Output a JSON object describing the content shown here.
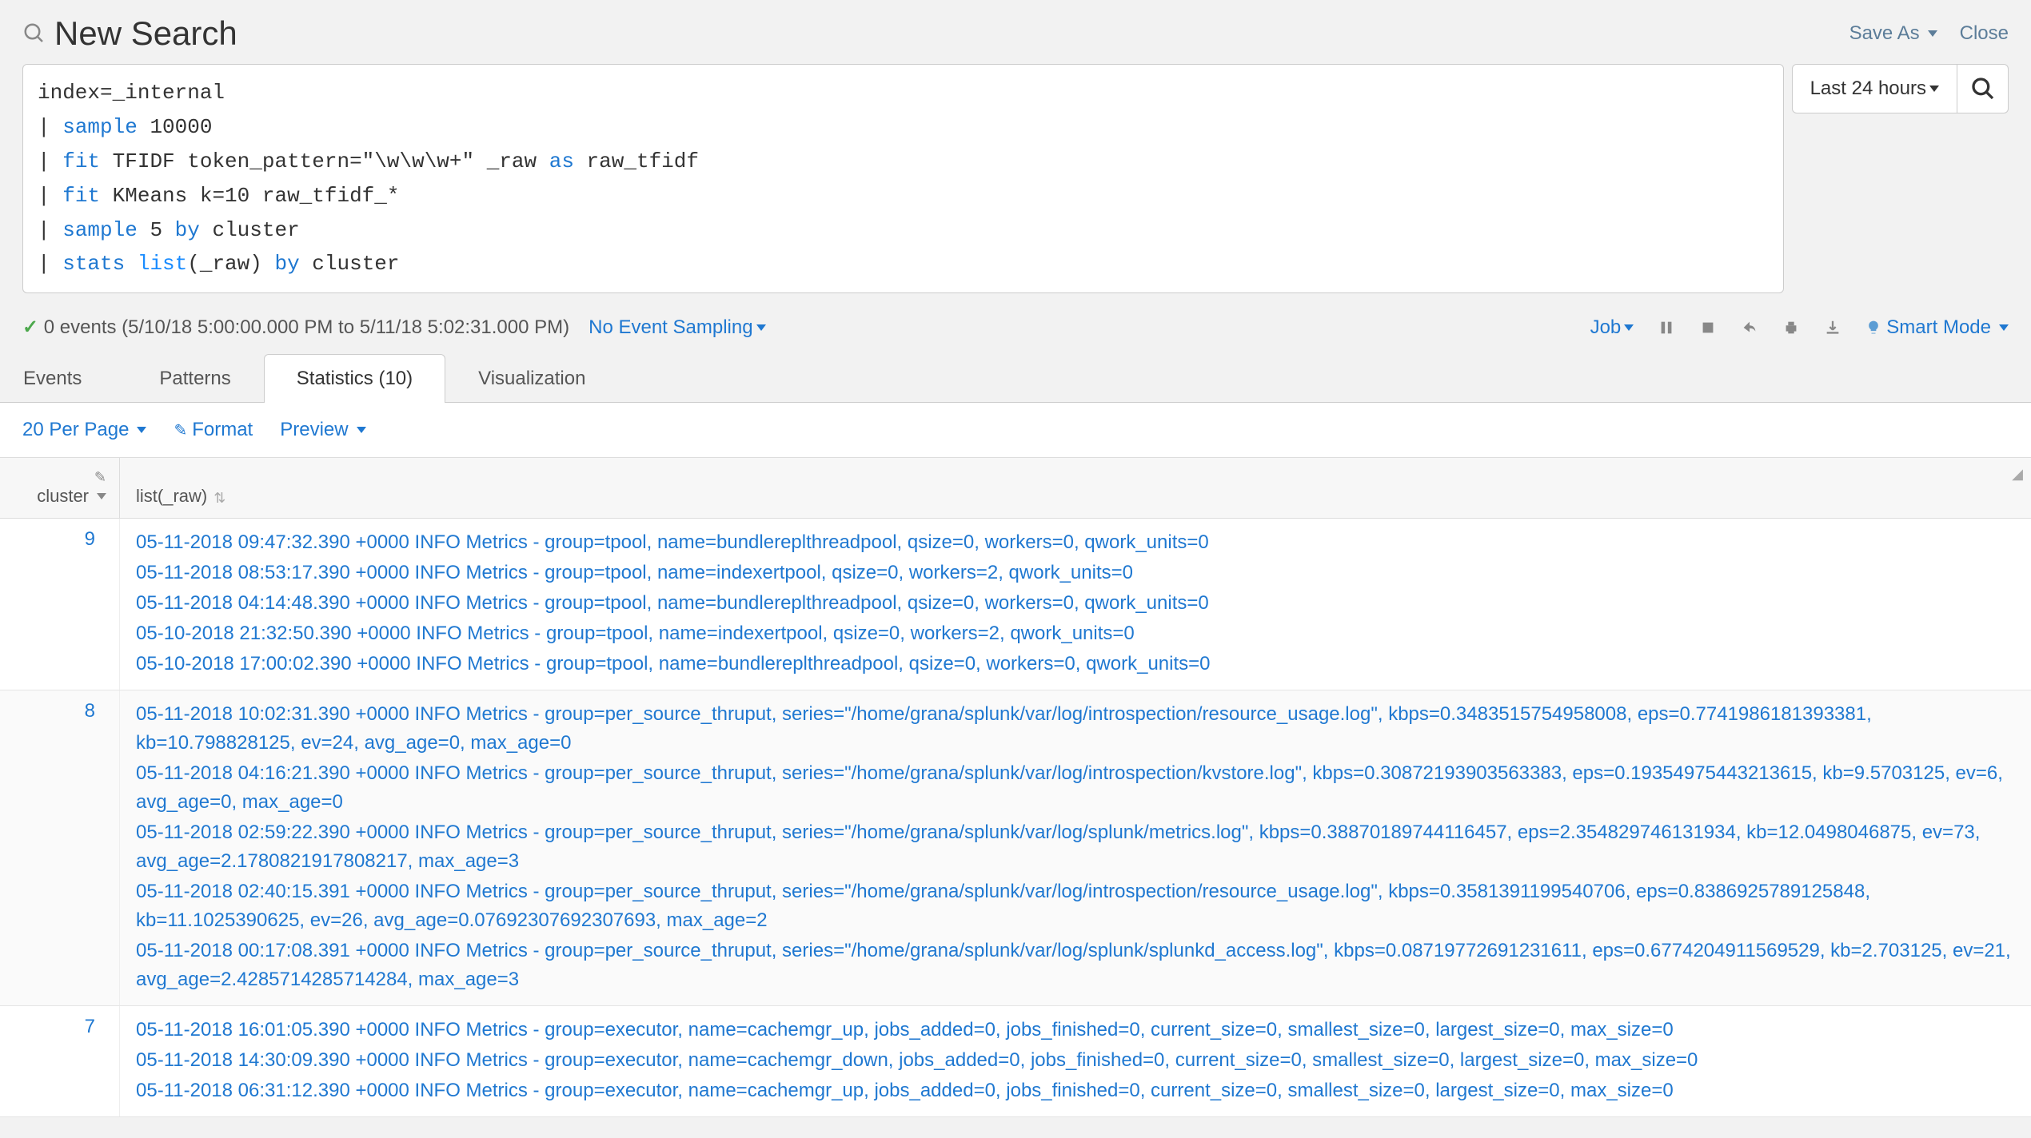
{
  "header": {
    "title": "New Search",
    "save_as": "Save As",
    "close": "Close"
  },
  "search": {
    "line1_prefix": "index=_internal",
    "l2_cmd": "sample",
    "l2_rest": " 10000",
    "l3_cmd": "fit",
    "l3_rest1": " TFIDF token_pattern=\"\\w\\w\\w+\" _raw ",
    "l3_as": "as",
    "l3_rest2": " raw_tfidf",
    "l4_cmd": "fit",
    "l4_rest": " KMeans k=10 raw_tfidf_*",
    "l5_cmd": "sample",
    "l5_rest1": " 5 ",
    "l5_by": "by",
    "l5_rest2": " cluster",
    "l6_cmd": "stats",
    "l6_fn": " list",
    "l6_rest1": "(_raw) ",
    "l6_by": "by",
    "l6_rest2": " cluster",
    "time_label": "Last 24 hours"
  },
  "status": {
    "events_text": "0 events (5/10/18 5:00:00.000 PM to 5/11/18 5:02:31.000 PM)",
    "sampling": "No Event Sampling",
    "job": "Job",
    "smart_mode": "Smart Mode"
  },
  "tabs": {
    "events": "Events",
    "patterns": "Patterns",
    "statistics": "Statistics (10)",
    "visualization": "Visualization"
  },
  "results_bar": {
    "per_page": "20 Per Page",
    "format": "Format",
    "preview": "Preview"
  },
  "table": {
    "col_cluster": "cluster",
    "col_list": "list(_raw)",
    "rows": [
      {
        "cluster": "9",
        "lines": [
          "05-11-2018 09:47:32.390 +0000 INFO Metrics - group=tpool, name=bundlereplthreadpool, qsize=0, workers=0, qwork_units=0",
          "05-11-2018 08:53:17.390 +0000 INFO Metrics - group=tpool, name=indexertpool, qsize=0, workers=2, qwork_units=0",
          "05-11-2018 04:14:48.390 +0000 INFO Metrics - group=tpool, name=bundlereplthreadpool, qsize=0, workers=0, qwork_units=0",
          "05-10-2018 21:32:50.390 +0000 INFO Metrics - group=tpool, name=indexertpool, qsize=0, workers=2, qwork_units=0",
          "05-10-2018 17:00:02.390 +0000 INFO Metrics - group=tpool, name=bundlereplthreadpool, qsize=0, workers=0, qwork_units=0"
        ]
      },
      {
        "cluster": "8",
        "lines": [
          "05-11-2018 10:02:31.390 +0000 INFO Metrics - group=per_source_thruput, series=\"/home/grana/splunk/var/log/introspection/resource_usage.log\", kbps=0.3483515754958008, eps=0.7741986181393381, kb=10.798828125, ev=24, avg_age=0, max_age=0",
          "05-11-2018 04:16:21.390 +0000 INFO Metrics - group=per_source_thruput, series=\"/home/grana/splunk/var/log/introspection/kvstore.log\", kbps=0.30872193903563383, eps=0.19354975443213615, kb=9.5703125, ev=6, avg_age=0, max_age=0",
          "05-11-2018 02:59:22.390 +0000 INFO Metrics - group=per_source_thruput, series=\"/home/grana/splunk/var/log/splunk/metrics.log\", kbps=0.38870189744116457, eps=2.354829746131934, kb=12.0498046875, ev=73, avg_age=2.1780821917808217, max_age=3",
          "05-11-2018 02:40:15.391 +0000 INFO Metrics - group=per_source_thruput, series=\"/home/grana/splunk/var/log/introspection/resource_usage.log\", kbps=0.3581391199540706, eps=0.8386925789125848, kb=11.1025390625, ev=26, avg_age=0.07692307692307693, max_age=2",
          "05-11-2018 00:17:08.391 +0000 INFO Metrics - group=per_source_thruput, series=\"/home/grana/splunk/var/log/splunk/splunkd_access.log\", kbps=0.08719772691231611, eps=0.6774204911569529, kb=2.703125, ev=21, avg_age=2.4285714285714284, max_age=3"
        ]
      },
      {
        "cluster": "7",
        "lines": [
          "05-11-2018 16:01:05.390 +0000 INFO Metrics - group=executor, name=cachemgr_up, jobs_added=0, jobs_finished=0, current_size=0, smallest_size=0, largest_size=0, max_size=0",
          "05-11-2018 14:30:09.390 +0000 INFO Metrics - group=executor, name=cachemgr_down, jobs_added=0, jobs_finished=0, current_size=0, smallest_size=0, largest_size=0, max_size=0",
          "05-11-2018 06:31:12.390 +0000 INFO Metrics - group=executor, name=cachemgr_up, jobs_added=0, jobs_finished=0, current_size=0, smallest_size=0, largest_size=0, max_size=0"
        ]
      }
    ]
  }
}
